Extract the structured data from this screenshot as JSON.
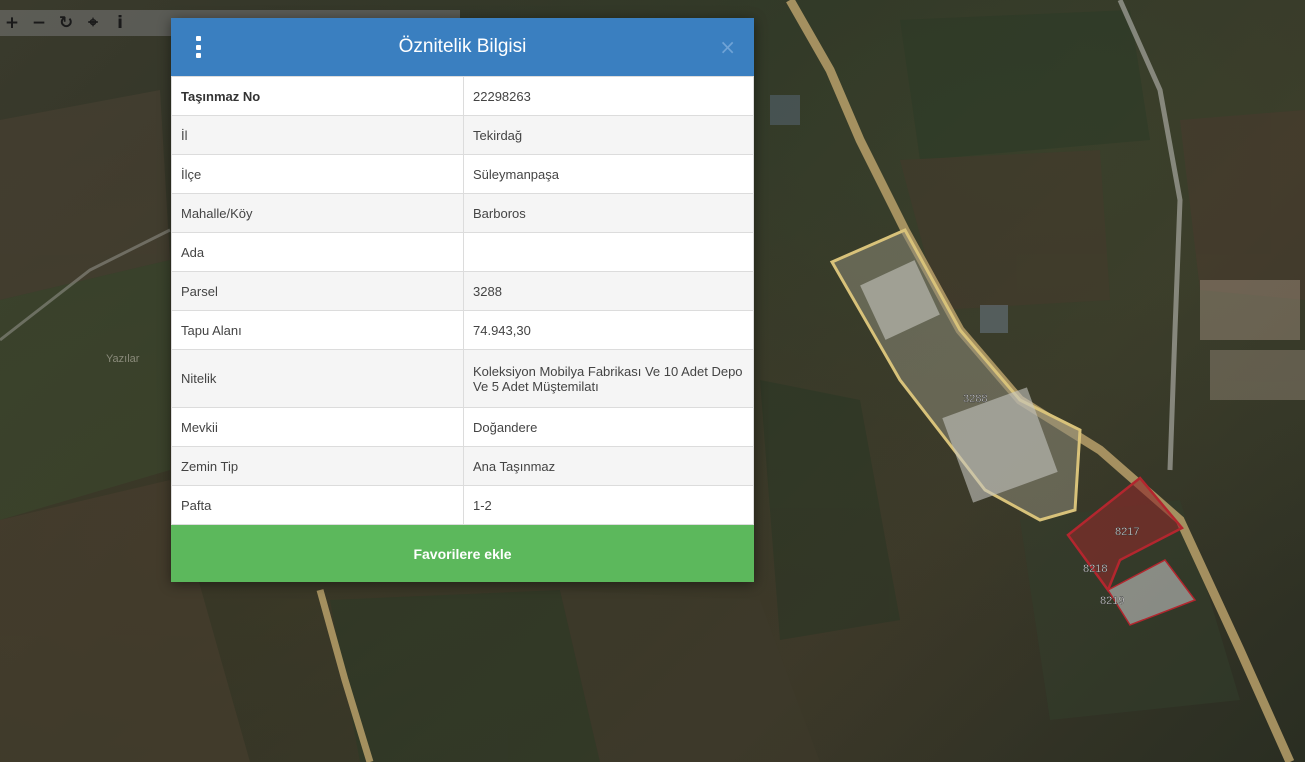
{
  "toolbar": {
    "buttons": [
      {
        "name": "zoom-in-button",
        "glyph": "+"
      },
      {
        "name": "zoom-out-button",
        "glyph": "−"
      },
      {
        "name": "refresh-button",
        "glyph": "↻"
      },
      {
        "name": "locate-button",
        "glyph": "⌖"
      },
      {
        "name": "info-button",
        "glyph": "i"
      }
    ]
  },
  "dialog": {
    "title": "Öznitelik Bilgisi",
    "close_glyph": "×",
    "rows": [
      {
        "key": "Taşınmaz No",
        "value": "22298263"
      },
      {
        "key": "İl",
        "value": "Tekirdağ"
      },
      {
        "key": "İlçe",
        "value": "Süleymanpaşa"
      },
      {
        "key": "Mahalle/Köy",
        "value": "Barboros"
      },
      {
        "key": "Ada",
        "value": ""
      },
      {
        "key": "Parsel",
        "value": "3288"
      },
      {
        "key": "Tapu Alanı",
        "value": "74.943,30"
      },
      {
        "key": "Nitelik",
        "value": "Koleksiyon Mobilya Fabrikası Ve 10 Adet Depo Ve 5 Adet Müştemilatı"
      },
      {
        "key": "Mevkii",
        "value": "Doğandere"
      },
      {
        "key": "Zemin Tip",
        "value": "Ana Taşınmaz"
      },
      {
        "key": "Pafta",
        "value": "1-2"
      }
    ],
    "favorite_label": "Favorilere ekle"
  },
  "map": {
    "labels": {
      "parcel_main": "3288",
      "parcel_a": "8217",
      "parcel_b": "8218",
      "parcel_c": "8219",
      "place": "Yazılar"
    },
    "colors": {
      "parcel_outline": "#d8c27a",
      "highlight": "#b3262e"
    }
  }
}
